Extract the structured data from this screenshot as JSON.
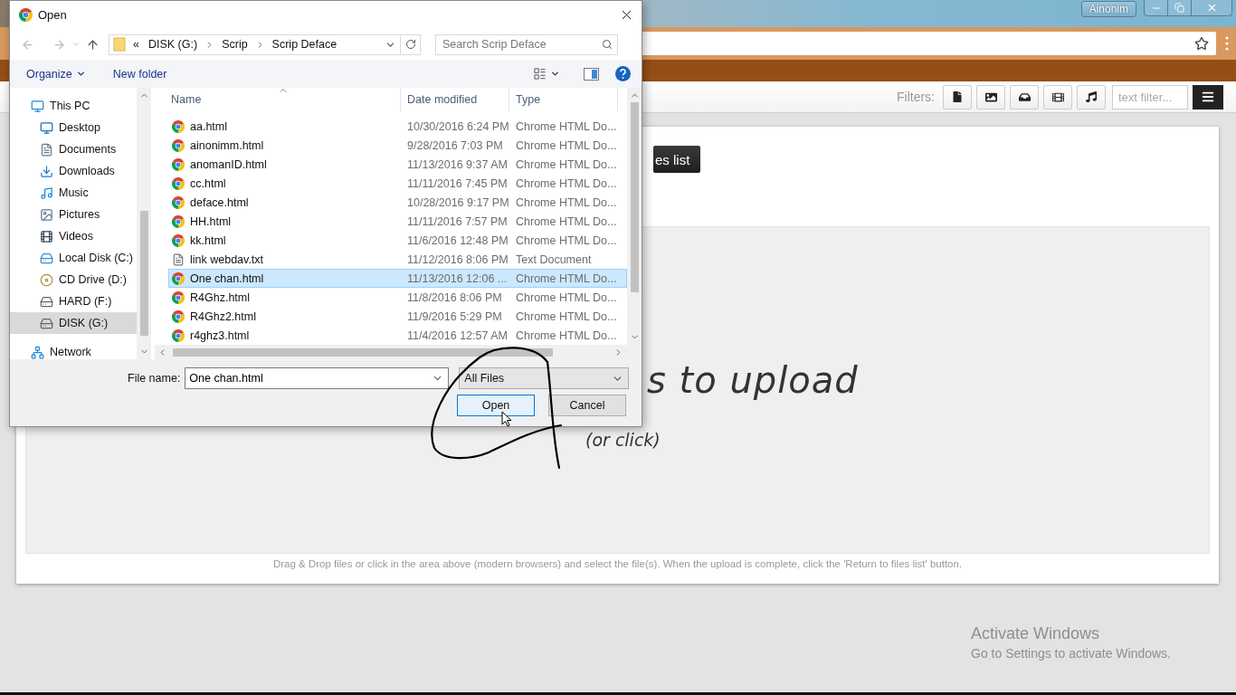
{
  "browser": {
    "user": "Ainonim",
    "filters_label": "Filters:",
    "filter_placeholder": "text filter...",
    "return_button": "es list",
    "drop_text": "s to upload",
    "drop_subtext": "(or click)",
    "help_text": "Drag & Drop files or click in the area above (modern browsers) and select the file(s). When the upload is complete, click the 'Return to files list' button."
  },
  "os_notice": {
    "title": "Activate Windows",
    "subtitle": "Go to Settings to activate Windows."
  },
  "dialog": {
    "title": "Open",
    "overflow_mark": "«",
    "path": [
      "DISK (G:)",
      "Scrip",
      "Scrip Deface"
    ],
    "search_placeholder": "Search Scrip Deface",
    "toolbar": {
      "organize": "Organize",
      "new_folder": "New folder"
    },
    "nav": [
      {
        "label": "This PC",
        "kind": "pc",
        "selected": false,
        "children": [
          {
            "label": "Desktop",
            "kind": "desktop",
            "selected": false
          },
          {
            "label": "Documents",
            "kind": "documents",
            "selected": false
          },
          {
            "label": "Downloads",
            "kind": "downloads",
            "selected": false
          },
          {
            "label": "Music",
            "kind": "music",
            "selected": false
          },
          {
            "label": "Pictures",
            "kind": "pictures",
            "selected": false
          },
          {
            "label": "Videos",
            "kind": "videos",
            "selected": false
          },
          {
            "label": "Local Disk (C:)",
            "kind": "system",
            "selected": false
          },
          {
            "label": "CD Drive (D:)",
            "kind": "disc",
            "selected": false
          },
          {
            "label": "HARD (F:)",
            "kind": "drive",
            "selected": false
          },
          {
            "label": "DISK (G:)",
            "kind": "drive",
            "selected": true
          }
        ]
      },
      {
        "label": "Network",
        "kind": "network",
        "selected": false
      }
    ],
    "columns": [
      "Name",
      "Date modified",
      "Type"
    ],
    "files": [
      {
        "name": "aa.html",
        "date": "10/30/2016 6:24 PM",
        "type": "Chrome HTML Do...",
        "kind": "html",
        "selected": false
      },
      {
        "name": "ainonimm.html",
        "date": "9/28/2016 7:03 PM",
        "type": "Chrome HTML Do...",
        "kind": "html",
        "selected": false
      },
      {
        "name": "anomanID.html",
        "date": "11/13/2016 9:37 AM",
        "type": "Chrome HTML Do...",
        "kind": "html",
        "selected": false
      },
      {
        "name": "cc.html",
        "date": "11/11/2016 7:45 PM",
        "type": "Chrome HTML Do...",
        "kind": "html",
        "selected": false
      },
      {
        "name": "deface.html",
        "date": "10/28/2016 9:17 PM",
        "type": "Chrome HTML Do...",
        "kind": "html",
        "selected": false
      },
      {
        "name": "HH.html",
        "date": "11/11/2016 7:57 PM",
        "type": "Chrome HTML Do...",
        "kind": "html",
        "selected": false
      },
      {
        "name": "kk.html",
        "date": "11/6/2016 12:48 PM",
        "type": "Chrome HTML Do...",
        "kind": "html",
        "selected": false
      },
      {
        "name": "link webdav.txt",
        "date": "11/12/2016 8:06 PM",
        "type": "Text Document",
        "kind": "text",
        "selected": false
      },
      {
        "name": "One chan.html",
        "date": "11/13/2016 12:06 ...",
        "type": "Chrome HTML Do...",
        "kind": "html",
        "selected": true
      },
      {
        "name": "R4Ghz.html",
        "date": "11/8/2016 8:06 PM",
        "type": "Chrome HTML Do...",
        "kind": "html",
        "selected": false
      },
      {
        "name": "R4Ghz2.html",
        "date": "11/9/2016 5:29 PM",
        "type": "Chrome HTML Do...",
        "kind": "html",
        "selected": false
      },
      {
        "name": "r4ghz3.html",
        "date": "11/4/2016 12:57 AM",
        "type": "Chrome HTML Do...",
        "kind": "html",
        "selected": false
      }
    ],
    "file_name_label": "File name:",
    "file_name": "One chan.html",
    "file_filter": "All Files",
    "buttons": [
      {
        "label": "Open",
        "default": true
      },
      {
        "label": "Cancel",
        "default": false
      }
    ]
  }
}
